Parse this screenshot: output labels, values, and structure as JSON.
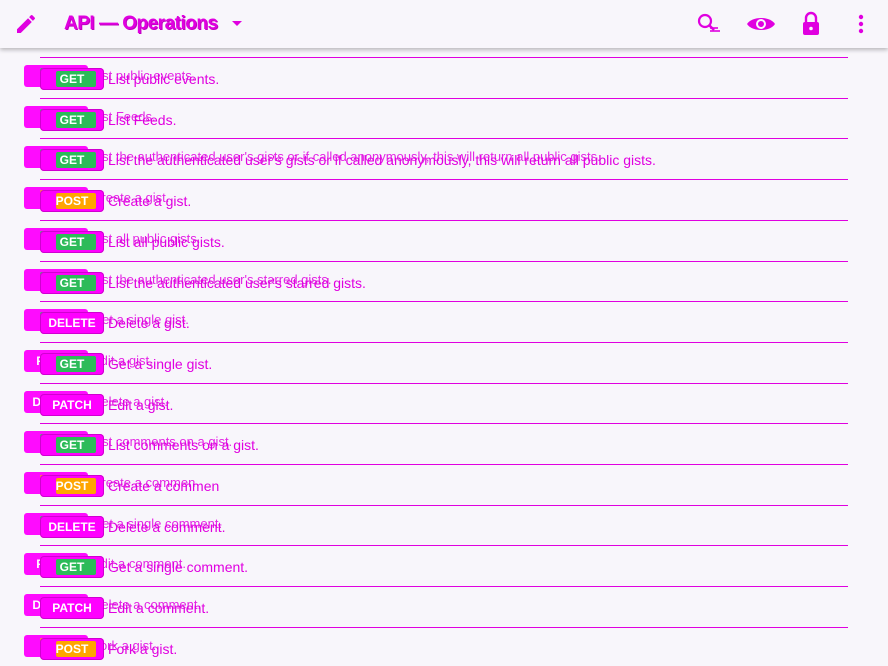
{
  "app": {
    "title": "API — Operations"
  },
  "colors": {
    "accent": "#e000e0",
    "badge": "#ff00ff",
    "get": "#2dbb59",
    "post": "#ffa500",
    "delete": "#ff00ff",
    "patch": "#ff00ff"
  },
  "icons": {
    "edit": "edit-icon",
    "dropdown": "chevron-down-icon",
    "search": "search-icon",
    "visibility": "eye-icon",
    "lock": "lock-icon",
    "more": "more-vert-icon"
  },
  "operations": [
    {
      "method": "GET",
      "summary": "List public events."
    },
    {
      "method": "GET",
      "summary": "List Feeds."
    },
    {
      "method": "GET",
      "summary": "List the authenticated user's gists or if called anonymously, this will return all public gists."
    },
    {
      "method": "POST",
      "summary": "Create a gist."
    },
    {
      "method": "GET",
      "summary": "List all public gists."
    },
    {
      "method": "GET",
      "summary": "List the authenticated user's starred gists."
    },
    {
      "method": "DELETE",
      "summary": "Delete a gist."
    },
    {
      "method": "GET",
      "summary": "Get a single gist."
    },
    {
      "method": "PATCH",
      "summary": "Edit a gist."
    },
    {
      "method": "GET",
      "summary": "List comments on a gist."
    },
    {
      "method": "POST",
      "summary": "Create a commen"
    },
    {
      "method": "DELETE",
      "summary": "Delete a comment."
    },
    {
      "method": "GET",
      "summary": "Get a single comment."
    },
    {
      "method": "PATCH",
      "summary": "Edit a comment."
    },
    {
      "method": "POST",
      "summary": "Fork a gist."
    }
  ],
  "ghost_operations": [
    {
      "method": "GET",
      "summary": "List public events."
    },
    {
      "method": "GET",
      "summary": "List Feeds."
    },
    {
      "method": "GET",
      "summary": "List the authenticated user's gists or if called anonymously, this will return all public gists."
    },
    {
      "method": "POST",
      "summary": "Create a gist."
    },
    {
      "method": "GET",
      "summary": "List all public gists."
    },
    {
      "method": "GET",
      "summary": "List the authenticated user's starred gists."
    },
    {
      "method": "GET",
      "summary": "Get a single gist."
    },
    {
      "method": "PATCH",
      "summary": "Edit a gist."
    },
    {
      "method": "DELETE",
      "summary": "Delete a gist."
    },
    {
      "method": "GET",
      "summary": "List comments on a gist."
    },
    {
      "method": "POST",
      "summary": "Create a commen"
    },
    {
      "method": "GET",
      "summary": "Get a single comment."
    },
    {
      "method": "PATCH",
      "summary": "Edit a comment."
    },
    {
      "method": "DELETE",
      "summary": "Delete a comment."
    },
    {
      "method": "POST",
      "summary": "Fork a gist."
    }
  ]
}
